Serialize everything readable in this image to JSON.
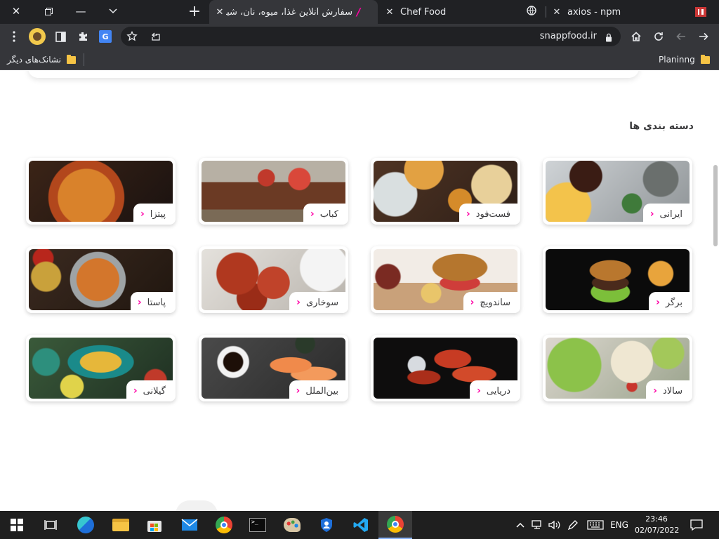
{
  "browser": {
    "tabs": [
      {
        "title": "سفارش آنلاین غذا، میوه، نان، شیرینی",
        "active": true
      },
      {
        "title": "Chef Food",
        "active": false
      },
      {
        "title": "axios - npm",
        "active": false
      }
    ],
    "url": "snappfood.ir",
    "bookmarks": {
      "other": "نشانک‌های دیگر",
      "planinng": "Planinng"
    }
  },
  "page": {
    "section_title": "دسته بندی ها",
    "categories": [
      {
        "label": "ایرانی"
      },
      {
        "label": "فست‌فود"
      },
      {
        "label": "کباب"
      },
      {
        "label": "پیتزا"
      },
      {
        "label": "برگر"
      },
      {
        "label": "ساندویچ"
      },
      {
        "label": "سوخاری"
      },
      {
        "label": "پاستا"
      },
      {
        "label": "سالاد"
      },
      {
        "label": "دریایی"
      },
      {
        "label": "بین‌الملل"
      },
      {
        "label": "گیلانی"
      }
    ]
  },
  "taskbar": {
    "lang": "ENG",
    "time": "23:46",
    "date": "02/07/2022"
  },
  "colors": {
    "accent": "#ff00a6",
    "chrome_dark": "#202124",
    "chrome_toolbar": "#35363a",
    "taskbar": "#1f1f1f"
  }
}
